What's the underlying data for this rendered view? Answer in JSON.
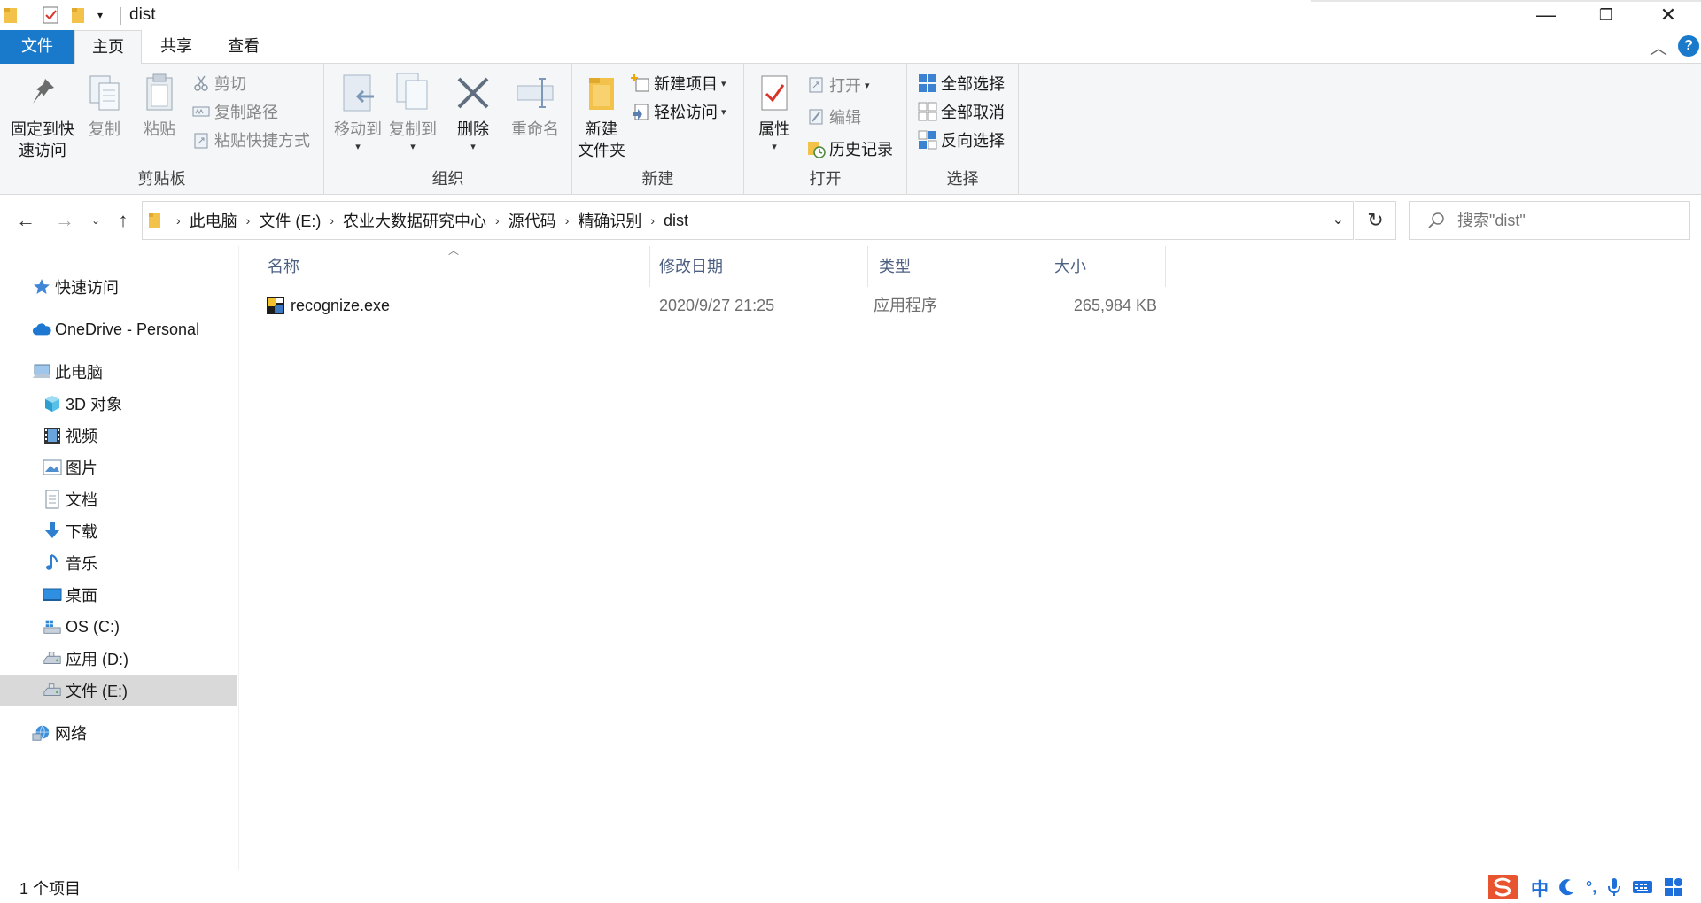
{
  "window": {
    "title": "dist",
    "minimize": "—",
    "restore": "❐",
    "close": "✕"
  },
  "ribbon_tabs": {
    "file": "文件",
    "home": "主页",
    "share": "共享",
    "view": "查看"
  },
  "ribbon": {
    "clipboard": {
      "label": "剪贴板",
      "pin_line1": "固定到快",
      "pin_line2": "速访问",
      "copy": "复制",
      "paste": "粘贴",
      "cut": "剪切",
      "copy_path": "复制路径",
      "paste_shortcut": "粘贴快捷方式"
    },
    "organize": {
      "label": "组织",
      "move_to": "移动到",
      "copy_to": "复制到",
      "delete": "删除",
      "rename": "重命名"
    },
    "new": {
      "label": "新建",
      "new_folder_line1": "新建",
      "new_folder_line2": "文件夹",
      "new_item": "新建项目",
      "easy_access": "轻松访问"
    },
    "open": {
      "label": "打开",
      "properties": "属性",
      "open": "打开",
      "edit": "编辑",
      "history": "历史记录"
    },
    "select": {
      "label": "选择",
      "select_all": "全部选择",
      "select_none": "全部取消",
      "invert": "反向选择"
    }
  },
  "address": {
    "crumbs": [
      "此电脑",
      "文件 (E:)",
      "农业大数据研究中心",
      "源代码",
      "精确识别",
      "dist"
    ],
    "search_placeholder": "搜索\"dist\""
  },
  "nav": {
    "quick_access": "快速访问",
    "onedrive": "OneDrive - Personal",
    "this_pc": "此电脑",
    "objects3d": "3D 对象",
    "videos": "视频",
    "pictures": "图片",
    "documents": "文档",
    "downloads": "下载",
    "music": "音乐",
    "desktop": "桌面",
    "drive_c": "OS (C:)",
    "drive_d": "应用 (D:)",
    "drive_e": "文件 (E:)",
    "network": "网络"
  },
  "columns": {
    "name": "名称",
    "date": "修改日期",
    "type": "类型",
    "size": "大小"
  },
  "files": [
    {
      "name": "recognize.exe",
      "date": "2020/9/27 21:25",
      "type": "应用程序",
      "size": "265,984 KB"
    }
  ],
  "status": {
    "count": "1 个项目"
  },
  "ime": {
    "lang": "中",
    "punct": "°,"
  },
  "colors": {
    "accent": "#1979ca",
    "folder": "#f3c24b",
    "ribbon_bg": "#f5f6f7",
    "selected": "#d9d9d9",
    "header_text": "#4d6082"
  }
}
